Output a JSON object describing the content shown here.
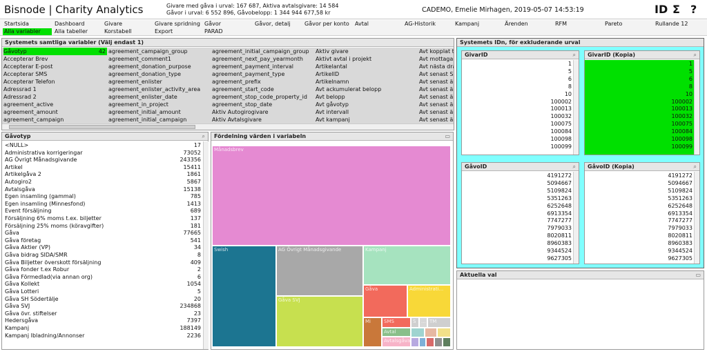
{
  "header": {
    "title": "Bisnode | Charity Analytics",
    "stats_line1": "Givare med gåva i urval: 167 687, Aktiva avtalsgivare: 14 584",
    "stats_line2": "Gåvor i urval: 6 552 896, Gåvobelopp: 1 344 944 677,58 kr",
    "user_info": "CADEMO, Emelie Mirhagen, 2019-05-07 14:53:19",
    "icons": {
      "id": "ID",
      "sum": "Σ",
      "help": "?"
    }
  },
  "nav": {
    "row1": [
      "Startsida",
      "Dashboard",
      "Givare",
      "Givare spridning",
      "Gåvor",
      "Gåvor, detalj",
      "Gåvor per konto",
      "Avtal",
      "AG-Historik",
      "Kampanj",
      "Ärenden",
      "RFM",
      "Pareto",
      "Rullande 12"
    ],
    "row2": [
      "Alla variabler",
      "Alla tabeller",
      "Korstabell",
      "Export",
      "PARAD"
    ],
    "active": "Alla variabler"
  },
  "variables_panel": {
    "title": "Systemets samtliga variabler (Välj endast 1)",
    "selected_count": "42",
    "columns": [
      [
        "Gåvotyp",
        "Accepterar Brev",
        "Accepterar E-post",
        "Accepterar SMS",
        "Accepterar Telefon",
        "Adressrad 1",
        "Adressrad 2",
        "agreement_active",
        "agreement_amount",
        "agreement_campaign"
      ],
      [
        "agreement_campaign_group",
        "agreement_comment1",
        "agreement_donation_purpose",
        "agreement_donation_type",
        "agreement_enlister",
        "agreement_enlister_activity_area",
        "agreement_enlister_date",
        "agreement_in_project",
        "agreement_initial_amount",
        "agreement_initial_campaign"
      ],
      [
        "agreement_initial_campaign_group",
        "agreement_next_pay_yearmonth",
        "agreement_payment_interval",
        "agreement_payment_type",
        "agreement_prefix",
        "agreement_start_code",
        "agreement_stop_code_property_id",
        "agreement_stop_date",
        "Aktiv Autogirogivare",
        "Aktiv Avtalsgivare"
      ],
      [
        "Aktiv givare",
        "Aktivt avtal i projekt",
        "Artikelantal",
        "ArtikelID",
        "Artikelnamn",
        "Avt ackumulerat belopp",
        "Avt belopp",
        "Avt gåvotyp",
        "Avt intervall",
        "Avt kampanj"
      ],
      [
        "Avt kopplat till",
        "Avt mottagare",
        "Avt nästa drag",
        "Avt senast Sl",
        "Avt senast än",
        "Avt senast än",
        "Avt senast än",
        "Avt senast än",
        "Avt senast än",
        "Avt senast än"
      ]
    ]
  },
  "gavotyp_panel": {
    "title": "Gåvotyp",
    "items": [
      {
        "label": "<NULL>",
        "value": "17"
      },
      {
        "label": "Administrativa korrigeringar",
        "value": "73052"
      },
      {
        "label": "AG Övrigt Månadsgivande",
        "value": "243356"
      },
      {
        "label": "Artikel",
        "value": "15411"
      },
      {
        "label": "Artikelgåva 2",
        "value": "1861"
      },
      {
        "label": "Autogiro2",
        "value": "5867"
      },
      {
        "label": "Avtalsgåva",
        "value": "15138"
      },
      {
        "label": "Egen insamling (gammal)",
        "value": "785"
      },
      {
        "label": "Egen insamling (Minnesfond)",
        "value": "1413"
      },
      {
        "label": "Event försäljning",
        "value": "689"
      },
      {
        "label": "Försäljning 6% moms t.ex. biljetter",
        "value": "137"
      },
      {
        "label": "Försäljning 25% moms (köravgifter)",
        "value": "181"
      },
      {
        "label": "Gåva",
        "value": "77665"
      },
      {
        "label": "Gåva  företag",
        "value": "541"
      },
      {
        "label": "Gåva Aktier (VP)",
        "value": "34"
      },
      {
        "label": "Gåva bidrag SIDA/SMR",
        "value": "8"
      },
      {
        "label": "Gåva Biljetter överskott försäljning",
        "value": "409"
      },
      {
        "label": "Gåva fonder t.ex Robur",
        "value": "2"
      },
      {
        "label": "Gåva Förmedlad(via annan org)",
        "value": "6"
      },
      {
        "label": "Gåva Kollekt",
        "value": "1054"
      },
      {
        "label": "Gåva Lotteri",
        "value": "5"
      },
      {
        "label": "Gåva SH Södertälje",
        "value": "20"
      },
      {
        "label": "Gåva SVJ",
        "value": "234868"
      },
      {
        "label": "Gåva övr. stiftelser",
        "value": "23"
      },
      {
        "label": "Hedersgåva",
        "value": "7397"
      },
      {
        "label": "Kampanj",
        "value": "188149"
      },
      {
        "label": "Kampanj Ibladning/Annonser",
        "value": "2236"
      }
    ]
  },
  "treemap_panel": {
    "title": "Fördelning värden i variabeln",
    "labels": {
      "manadsbrev": "Månadsbrev",
      "swish": "Swish",
      "ag_ovrigt": "AG Övrigt Månadsgivande",
      "kampanj": "Kampanj",
      "gava_svj": "Gåva SVJ",
      "gava": "Gåva",
      "administrativ": "Administrati...",
      "sms": "SMS",
      "tm": "TM",
      "avtal": "Avtal",
      "avtalsg": "Avtalsgåva",
      "misc": "Mi",
      "s": "S",
      "dots": "..."
    },
    "colors": {
      "manadsbrev": "#e58ad2",
      "swish": "#1c7591",
      "ag_ovrigt": "#a8a8a8",
      "kampanj": "#a6e3bf",
      "gava_svj": "#c7e04f",
      "gava": "#f26a5c",
      "administrativ": "#f8d838",
      "tm": "#cfcfcf",
      "sms": "#f26a5c",
      "avtal": "#8abf8a",
      "avtalsg": "#f7b3c8",
      "misc": "#c9783a"
    }
  },
  "ids_panel": {
    "title": "Systemets IDn, för exkluderande urval",
    "givarid": {
      "title": "GivarID",
      "values": [
        "1",
        "5",
        "6",
        "8",
        "10",
        "100002",
        "100013",
        "100032",
        "100075",
        "100084",
        "100098",
        "100099"
      ]
    },
    "givarid_kopia": {
      "title": "GivarID (Kopia)",
      "values": [
        "1",
        "5",
        "6",
        "8",
        "10",
        "100002",
        "100013",
        "100032",
        "100075",
        "100084",
        "100098",
        "100099"
      ]
    },
    "gavoid": {
      "title": "GåvoID",
      "values": [
        "4191272",
        "5094667",
        "5109824",
        "5351263",
        "6252648",
        "6913354",
        "7747277",
        "7979033",
        "8020811",
        "8960383",
        "9344524",
        "9627305"
      ]
    },
    "gavoid_kopia": {
      "title": "GåvoID (Kopia)",
      "values": [
        "4191272",
        "5094667",
        "5109824",
        "5351263",
        "6252648",
        "6913354",
        "7747277",
        "7979033",
        "8020811",
        "8960383",
        "9344524",
        "9627305"
      ]
    }
  },
  "current_panel": {
    "title": "Aktuella val"
  }
}
